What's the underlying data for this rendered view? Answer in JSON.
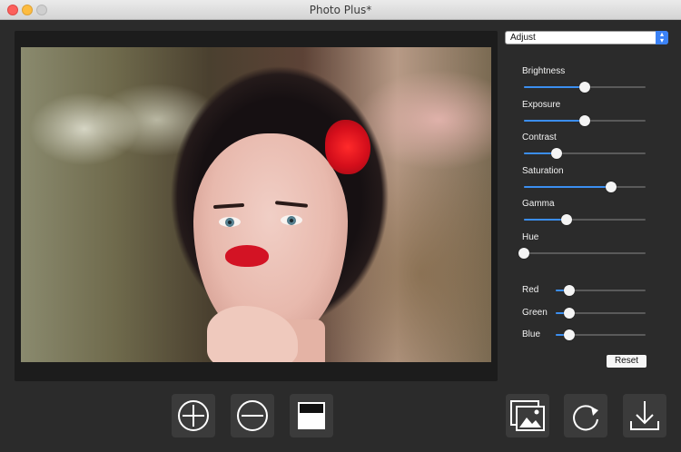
{
  "window": {
    "title": "Photo Plus*"
  },
  "mode_select": {
    "value": "Adjust"
  },
  "adjustments": [
    {
      "label": "Brightness",
      "value": 0.5
    },
    {
      "label": "Exposure",
      "value": 0.5
    },
    {
      "label": "Contrast",
      "value": 0.27
    },
    {
      "label": "Saturation",
      "value": 0.72
    },
    {
      "label": "Gamma",
      "value": 0.35
    },
    {
      "label": "Hue",
      "value": 0.0
    }
  ],
  "color_channels": [
    {
      "label": "Red",
      "value": 0.15
    },
    {
      "label": "Green",
      "value": 0.15
    },
    {
      "label": "Blue",
      "value": 0.15
    }
  ],
  "reset_label": "Reset",
  "toolbar": {
    "icons": [
      "zoom-in-icon",
      "zoom-out-icon",
      "compare-icon",
      "open-image-icon",
      "rotate-icon",
      "download-icon"
    ]
  },
  "colors": {
    "accent": "#3b8ef0",
    "background": "#2b2b2b",
    "panel": "#1c1c1c"
  }
}
